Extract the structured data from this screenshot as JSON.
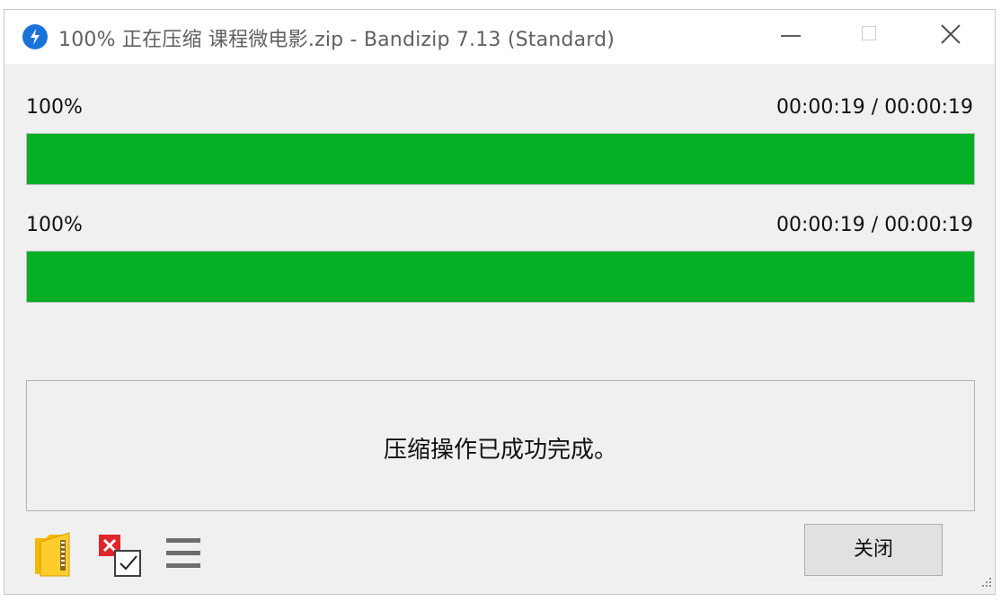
{
  "window": {
    "title": "100% 正在压缩 课程微电影.zip - Bandizip 7.13 (Standard)"
  },
  "progress": [
    {
      "percent_label": "100%",
      "time": "00:00:19 / 00:00:19",
      "fraction": 1.0
    },
    {
      "percent_label": "100%",
      "time": "00:00:19 / 00:00:19",
      "fraction": 1.0
    }
  ],
  "status": {
    "message": "压缩操作已成功完成。"
  },
  "buttons": {
    "close_label": "关闭"
  },
  "icons": {
    "app": "bandizip-logo-icon",
    "open_folder": "open-folder-icon",
    "close_when_done": "auto-close-checkbox-icon",
    "menu": "menu-icon"
  },
  "colors": {
    "progress_fill": "#06b025",
    "app_icon": "#1a73d9",
    "x_mark": "#e0262d"
  }
}
